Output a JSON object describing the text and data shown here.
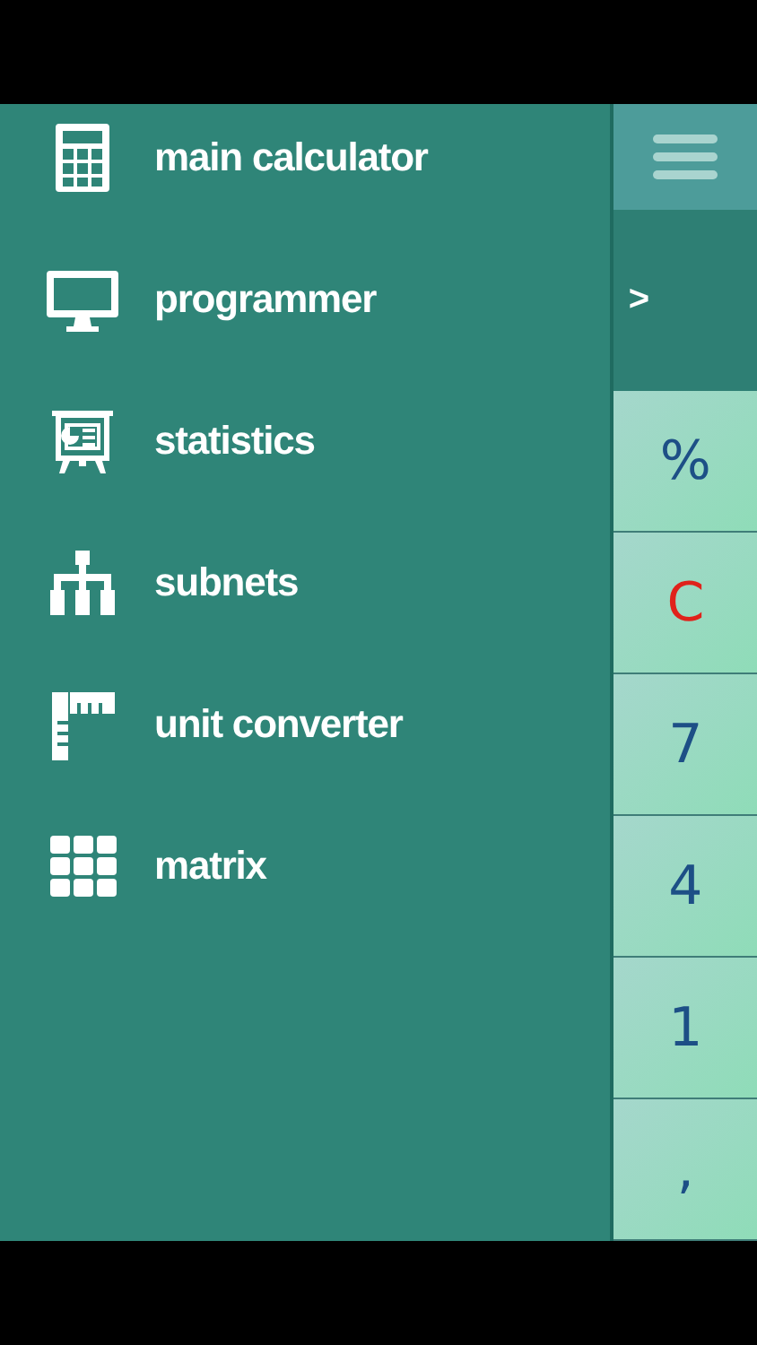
{
  "menu": [
    {
      "label": "main calculator",
      "kind": "calculator"
    },
    {
      "label": "programmer",
      "kind": "monitor"
    },
    {
      "label": "statistics",
      "kind": "presentation"
    },
    {
      "label": "subnets",
      "kind": "network"
    },
    {
      "label": "unit converter",
      "kind": "ruler"
    },
    {
      "label": "matrix",
      "kind": "grid"
    }
  ],
  "display": {
    "text": ">"
  },
  "keys": [
    {
      "label": "%",
      "kind": "op"
    },
    {
      "label": "C",
      "kind": "clear"
    },
    {
      "label": "7",
      "kind": "digit"
    },
    {
      "label": "4",
      "kind": "digit"
    },
    {
      "label": "1",
      "kind": "digit"
    },
    {
      "label": ",",
      "kind": "digit"
    }
  ]
}
